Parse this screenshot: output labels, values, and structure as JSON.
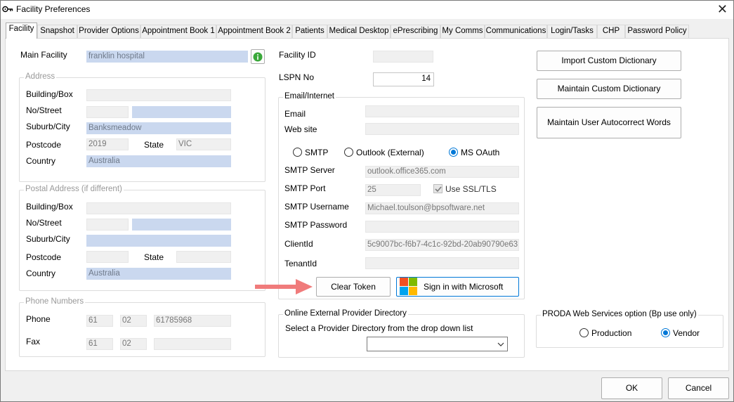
{
  "window": {
    "title": "Facility Preferences"
  },
  "tabs": [
    "Facility",
    "Snapshot",
    "Provider Options",
    "Appointment Book 1",
    "Appointment Book 2",
    "Patients",
    "Medical Desktop",
    "ePrescribing",
    "My Comms",
    "Communications",
    "Login/Tasks",
    "CHP",
    "Password Policy"
  ],
  "facility": {
    "main_facility_label": "Main Facility",
    "main_facility_value": "franklin hospital",
    "address": {
      "title": "Address",
      "building_label": "Building/Box",
      "street_label": "No/Street",
      "suburb_label": "Suburb/City",
      "suburb_value": "Banksmeadow",
      "postcode_label": "Postcode",
      "postcode_value": "2019",
      "state_label": "State",
      "state_value": "VIC",
      "country_label": "Country",
      "country_value": "Australia"
    },
    "postal": {
      "title": "Postal Address (if different)",
      "building_label": "Building/Box",
      "street_label": "No/Street",
      "suburb_label": "Suburb/City",
      "postcode_label": "Postcode",
      "state_label": "State",
      "country_label": "Country",
      "country_value": "Australia"
    },
    "phones": {
      "title": "Phone Numbers",
      "phone_label": "Phone",
      "phone_country": "61",
      "phone_area": "02",
      "phone_number": "61785968",
      "fax_label": "Fax",
      "fax_country": "61",
      "fax_area": "02",
      "fax_number": ""
    },
    "facility_id_label": "Facility ID",
    "lspn_label": "LSPN No",
    "lspn_value": "14",
    "email": {
      "title": "Email/Internet",
      "email_label": "Email",
      "website_label": "Web site",
      "opt_smtp": "SMTP",
      "opt_outlook": "Outlook (External)",
      "opt_msoauth": "MS OAuth",
      "selected": "MS OAuth",
      "smtp_server_label": "SMTP Server",
      "smtp_server_value": "outlook.office365.com",
      "smtp_port_label": "SMTP Port",
      "smtp_port_value": "25",
      "ssl_label": "Use SSL/TLS",
      "ssl_checked": true,
      "smtp_user_label": "SMTP Username",
      "smtp_user_value": "Michael.toulson@bpsoftware.net",
      "smtp_pass_label": "SMTP Password",
      "client_id_label": "ClientId",
      "client_id_value": "5c9007bc-f6b7-4c1c-92bd-20ab90790e63",
      "tenant_id_label": "TenantId",
      "clear_token_label": "Clear Token",
      "sign_in_label": "Sign in with Microsoft"
    },
    "directory": {
      "title": "Online External Provider Directory",
      "prompt": "Select a Provider Directory from the drop down list",
      "selected": ""
    },
    "import_dict_label": "Import Custom Dictionary",
    "maintain_dict_label": "Maintain Custom Dictionary",
    "maintain_autocorrect_label": "Maintain User Autocorrect Words",
    "proda": {
      "title": "PRODA Web Services option (Bp  use only)",
      "opt_production": "Production",
      "opt_vendor": "Vendor",
      "selected": "Vendor"
    }
  },
  "footer": {
    "ok_label": "OK",
    "cancel_label": "Cancel"
  },
  "colors": {
    "accent": "#0078d7",
    "highlight_field": "#cad8ef",
    "arrow": "#f07b7b"
  },
  "icons": {
    "app": "key-icon",
    "info": "info-icon",
    "close": "close-icon",
    "dropdown": "chevron-down-icon",
    "ms": "microsoft-logo-icon"
  }
}
